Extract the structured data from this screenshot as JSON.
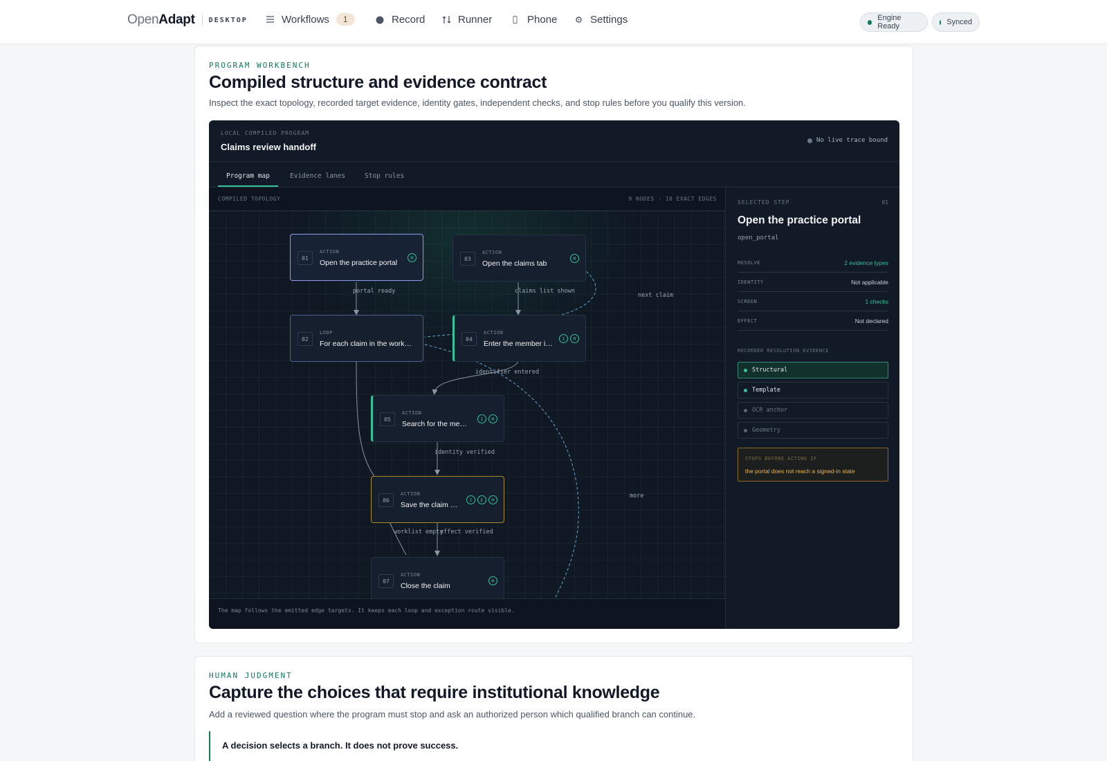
{
  "brand": {
    "open": "Open",
    "adapt": "Adapt",
    "sub": "DESKTOP"
  },
  "nav": {
    "workflows": "Workflows",
    "workflows_count": "1",
    "record": "Record",
    "runner": "Runner",
    "phone": "Phone",
    "settings": "Settings"
  },
  "status": {
    "engine": "Engine Ready",
    "sync": "Synced",
    "color": "#0f7a5a"
  },
  "workbench": {
    "eyebrow": "PROGRAM WORKBENCH",
    "title": "Compiled structure and evidence contract",
    "description": "Inspect the exact topology, recorded target evidence, identity gates, independent checks, and stop rules before you qualify this version.",
    "program_eyebrow": "LOCAL COMPILED PROGRAM",
    "program_name": "Claims review handoff",
    "trace": "No live trace bound",
    "tabs": [
      "Program map",
      "Evidence lanes",
      "Stop rules"
    ],
    "topology_label": "COMPILED TOPOLOGY",
    "topology_summary": "9 NODES · 10 EXACT EDGES",
    "footer": "The map follows the emitted edge targets. It keeps each loop and exception route visible."
  },
  "nodes": [
    {
      "num": "01",
      "kind": "ACTION",
      "label": "Open the practice portal",
      "badges": [
        "M"
      ]
    },
    {
      "num": "03",
      "kind": "ACTION",
      "label": "Open the claims tab",
      "badges": [
        "M"
      ]
    },
    {
      "num": "02",
      "kind": "LOOP",
      "label": "For each claim in the worklist",
      "badges": []
    },
    {
      "num": "04",
      "kind": "ACTION",
      "label": "Enter the member identifier",
      "badges": [
        "I",
        "M"
      ]
    },
    {
      "num": "05",
      "kind": "ACTION",
      "label": "Search for the member",
      "badges": [
        "I",
        "M"
      ]
    },
    {
      "num": "06",
      "kind": "ACTION",
      "label": "Save the claim review",
      "badges": [
        "I",
        "E",
        "M"
      ]
    },
    {
      "num": "07",
      "kind": "ACTION",
      "label": "Close the claim",
      "badges": [
        "M"
      ]
    }
  ],
  "edge_labels": {
    "portal_ready": "portal ready",
    "claims_list": "claims list shown",
    "next_claim": "next claim",
    "identifier": "identifier entered",
    "identity": "identity verified",
    "more": "more",
    "worklist_empty": "worklist empty",
    "effect": "effect verified"
  },
  "selected_step": {
    "eyebrow": "SELECTED STEP",
    "num": "01",
    "title": "Open the practice portal",
    "id": "open_portal",
    "rows": [
      {
        "key": "RESOLVE",
        "value": "2 evidence types",
        "highlight": true
      },
      {
        "key": "IDENTITY",
        "value": "Not applicable",
        "highlight": false
      },
      {
        "key": "SCREEN",
        "value": "1 checks",
        "highlight": true
      },
      {
        "key": "EFFECT",
        "value": "Not declared",
        "highlight": false
      }
    ],
    "evidence_eyebrow": "RECORDED RESOLUTION EVIDENCE",
    "evidence": [
      {
        "label": "Structural",
        "state": "active"
      },
      {
        "label": "Template",
        "state": "on"
      },
      {
        "label": "OCR anchor",
        "state": "off"
      },
      {
        "label": "Geometry",
        "state": "off"
      }
    ],
    "stop_label": "STOPS BEFORE ACTING IF",
    "stop_value": "the portal does not reach a signed-in state"
  },
  "judgment": {
    "eyebrow": "HUMAN JUDGMENT",
    "title": "Capture the choices that require institutional knowledge",
    "description": "Add a reviewed question where the program must stop and ask an authorized person which qualified branch can continue.",
    "callout_title": "A decision selects a branch. It does not prove success."
  },
  "colors": {
    "accent": "#34c39a",
    "warning": "#e6b64a",
    "selected_border": "#8f9cf5"
  }
}
